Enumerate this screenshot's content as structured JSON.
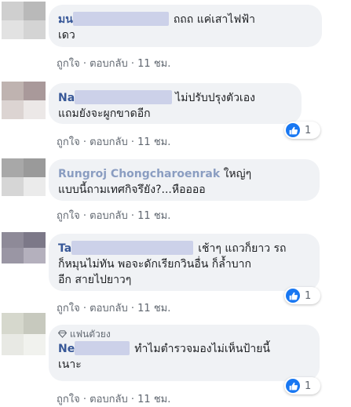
{
  "comments": [
    {
      "name": "มน",
      "name_suffix": "",
      "text_line1": "ถถถ แค่เสาไฟฟ้า",
      "text_line2": "เดว",
      "text_line3": "",
      "badge": "",
      "like": "ถูกใจ",
      "reply": "ตอบกลับ",
      "time": "11 ชม.",
      "reactions": ""
    },
    {
      "name": "Na",
      "name_suffix": "",
      "text_line1": "ไม่ปรับปรุงตัวเอง",
      "text_line2": "แถมยังจะผูกขาดอีก",
      "text_line3": "",
      "badge": "",
      "like": "ถูกใจ",
      "reply": "ตอบกลับ",
      "time": "11 ชม.",
      "reactions": "1"
    },
    {
      "name": "Rungroj Chongcharoenrak",
      "name_suffix": "",
      "text_line1": "ใหญ่ๆ",
      "text_line2": "แบบนี้ถามเทศกิจรึยัง?...หืออออ",
      "text_line3": "",
      "badge": "",
      "like": "ถูกใจ",
      "reply": "ตอบกลับ",
      "time": "11 ชม.",
      "reactions": ""
    },
    {
      "name": "Ta",
      "name_suffix": "",
      "text_line1": "เช้าๆ แถวก็ยาว รถ",
      "text_line2": "ก็หมุนไม่ทัน พอจะดักเรียกวินอื่น ก็ล้ำบาก",
      "text_line3": "อีก สายไปยาวๆ",
      "badge": "",
      "like": "ถูกใจ",
      "reply": "ตอบกลับ",
      "time": "11 ชม.",
      "reactions": "1"
    },
    {
      "name": "Ne",
      "name_suffix": "",
      "text_line1": "ทำไมตำรวจมองไม่เห็นป้ายนี้",
      "text_line2": "เนาะ",
      "text_line3": "",
      "badge": "แฟนตัวยง",
      "like": "ถูกใจ",
      "reply": "ตอบกลับ",
      "time": "11 ชม.",
      "reactions": "1"
    }
  ],
  "separator": "·",
  "icons": {
    "like": "thumbs-up-icon",
    "badge": "diamond-icon"
  },
  "colors": {
    "name": "#385898",
    "bubble": "#f0f2f5",
    "like_blue": "#1877f2",
    "meta": "#606770"
  }
}
